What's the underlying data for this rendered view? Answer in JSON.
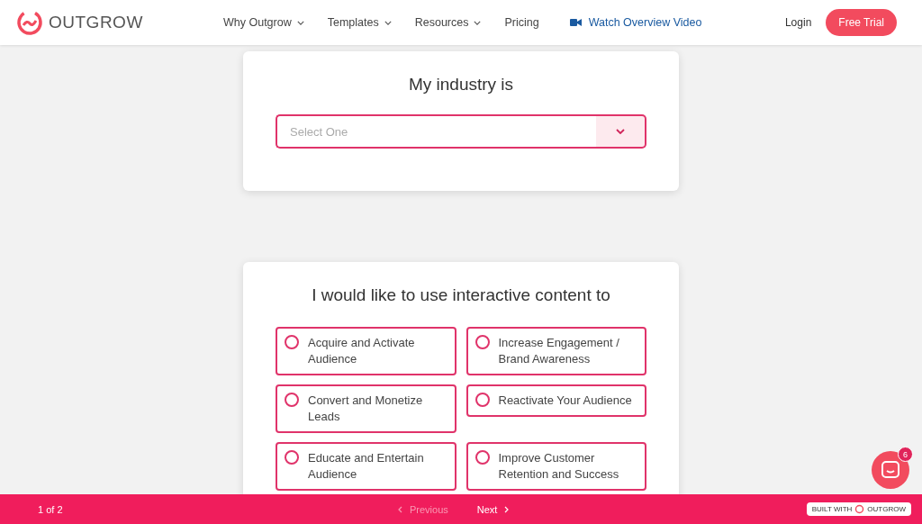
{
  "header": {
    "brand": "OUTGROW",
    "nav": [
      {
        "label": "Why Outgrow",
        "dropdown": true
      },
      {
        "label": "Templates",
        "dropdown": true
      },
      {
        "label": "Resources",
        "dropdown": true
      },
      {
        "label": "Pricing",
        "dropdown": false
      }
    ],
    "video_link": "Watch Overview Video",
    "login": "Login",
    "cta": "Free Trial"
  },
  "industry": {
    "title": "My industry is",
    "select": {
      "placeholder": "Select One"
    }
  },
  "purpose": {
    "title": "I would like to use interactive content to",
    "options": [
      {
        "label": "Acquire and Activate Audience",
        "selected": false
      },
      {
        "label": "Increase Engagement / Brand Awareness",
        "selected": false
      },
      {
        "label": "Convert and Monetize Leads",
        "selected": false
      },
      {
        "label": "Reactivate Your Audience",
        "selected": false
      },
      {
        "label": "Educate and Entertain Audience",
        "selected": false
      },
      {
        "label": "Improve Customer Retention and Success",
        "selected": false
      }
    ]
  },
  "footer": {
    "progress": "1 of 2",
    "previous": {
      "label": "Previous",
      "disabled": true
    },
    "next": {
      "label": "Next",
      "disabled": false
    },
    "badge_prefix": "BUILT WITH",
    "badge_brand": "OUTGROW"
  },
  "chat": {
    "badge": "6"
  }
}
